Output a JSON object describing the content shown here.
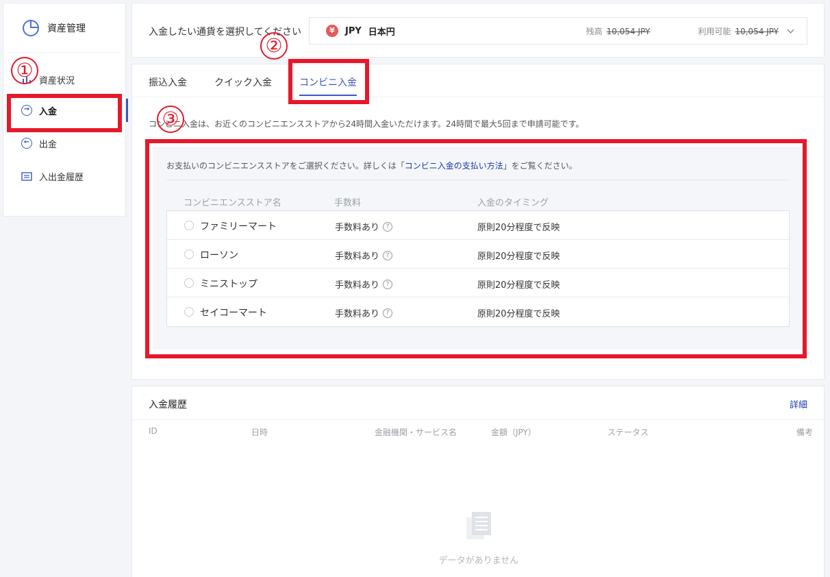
{
  "sidebar": {
    "title": "資産管理",
    "items": [
      {
        "label": "資産状況",
        "icon": "chart-bars-icon"
      },
      {
        "label": "入金",
        "icon": "deposit-arrow-icon"
      },
      {
        "label": "出金",
        "icon": "withdraw-arrow-icon"
      },
      {
        "label": "入出金履歴",
        "icon": "history-icon"
      }
    ]
  },
  "currency": {
    "prompt": "入金したい通貨を選択してください",
    "symbol": "¥",
    "code": "JPY",
    "name": "日本円",
    "balance_label": "残高",
    "balance_value": "10,054 JPY",
    "available_label": "利用可能",
    "available_value": "10,054 JPY"
  },
  "tabs": [
    {
      "label": "振込入金",
      "active": false
    },
    {
      "label": "クイック入金",
      "active": false
    },
    {
      "label": "コンビニ入金",
      "active": true
    }
  ],
  "convenience": {
    "description": "コンビニ入金は、お近くのコンビニエンスストアから24時間入金いただけます。24時間で最大5回まで申請可能です。",
    "note_prefix": "お支払いのコンビニエンスストアをご選択ください。詳しくは「",
    "note_link": "コンビニ入金の支払い方法",
    "note_suffix": "」をご覧ください。",
    "columns": [
      "コンビニエンスストア名",
      "手数料",
      "入金のタイミング"
    ],
    "stores": [
      {
        "name": "ファミリーマート",
        "fee": "手数料あり",
        "timing": "原則20分程度で反映"
      },
      {
        "name": "ローソン",
        "fee": "手数料あり",
        "timing": "原則20分程度で反映"
      },
      {
        "name": "ミニストップ",
        "fee": "手数料あり",
        "timing": "原則20分程度で反映"
      },
      {
        "name": "セイコーマート",
        "fee": "手数料あり",
        "timing": "原則20分程度で反映"
      }
    ]
  },
  "history": {
    "title": "入金履歴",
    "detail_link": "詳細",
    "columns": [
      "ID",
      "日時",
      "金融機関・サービス名",
      "金額（JPY）",
      "ステータス",
      "備考"
    ],
    "empty_text": "データがありません"
  },
  "annotations": [
    "①",
    "②",
    "③"
  ],
  "colors": {
    "accent": "#3a56c4",
    "annotation": "#e6182a",
    "link": "#1a3aa8"
  }
}
